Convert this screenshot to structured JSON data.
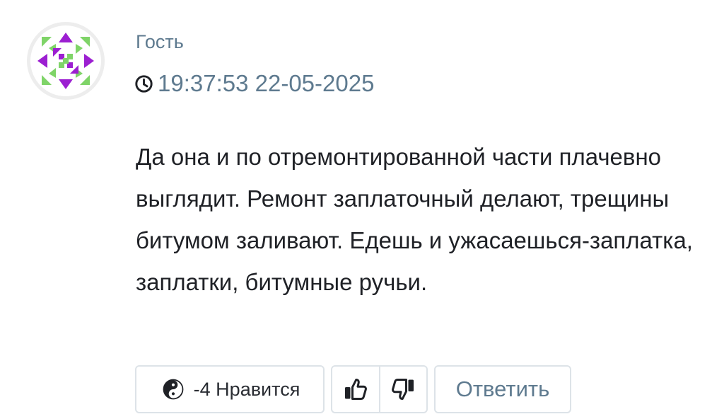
{
  "comment": {
    "author": "Гость",
    "time": "19:37:53 22-05-2025",
    "text": "Да она и по отремонтированной части плачевно выглядит. Ремонт заплаточный делают, трещины битумом заливают. Едешь и ужасаешься-заплатка, заплатки, битумные ручьи.",
    "rating_label": "-4 Нравится",
    "reply_label": "Ответить"
  },
  "icons": {
    "clock": "clock-icon",
    "rating": "yin-yang-icon",
    "like": "thumbs-up-icon",
    "dislike": "thumbs-down-icon"
  },
  "colors": {
    "meta": "#5e7a8f",
    "text": "#1f2126",
    "border": "#dde3e8",
    "avatar_purple": "#9c1fd1",
    "avatar_green": "#7fd468"
  }
}
